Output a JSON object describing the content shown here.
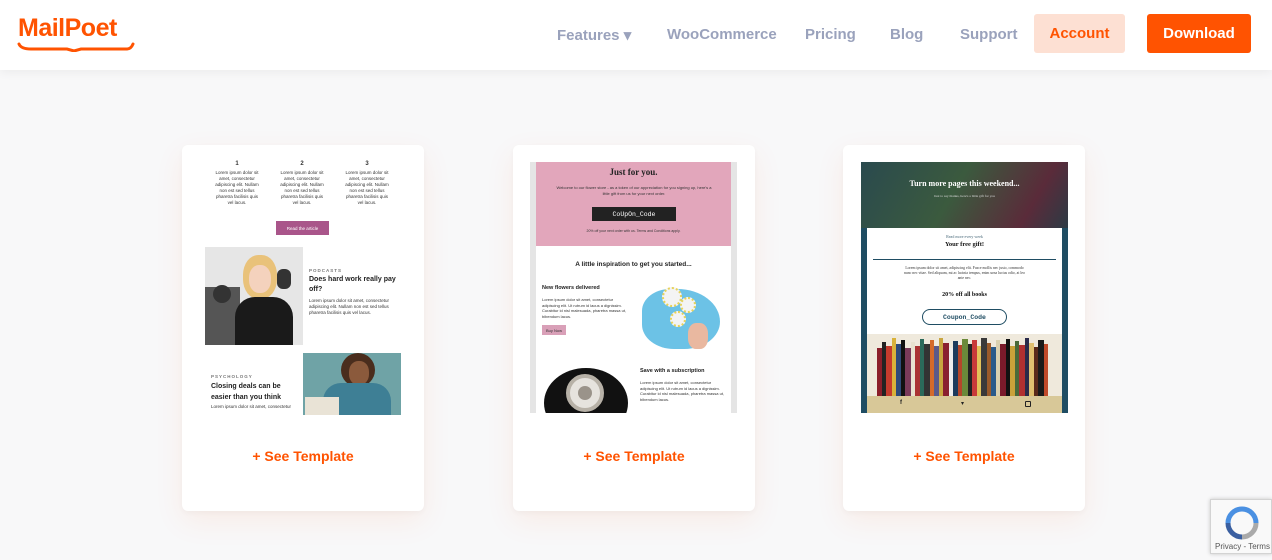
{
  "brand": {
    "name": "MailPoet",
    "accent": "#ff5301",
    "nav_color": "#9aa2bc"
  },
  "nav": {
    "features": "Features ▾",
    "woocommerce": "WooCommerce",
    "pricing": "Pricing",
    "blog": "Blog",
    "support": "Support",
    "account": "Account",
    "download": "Download"
  },
  "cards": [
    {
      "see_template": "+ See Template",
      "columns": [
        {
          "num": "1",
          "text": "Lorem ipsum dolor sit amet, consectetur adipiscing elit. Nullam non est sed tellus pharetra facilisis quis vel lacus."
        },
        {
          "num": "2",
          "text": "Lorem ipsum dolor sit amet, consectetur adipiscing elit. Nullam non est sed tellus pharetra facilisis quis vel lacus."
        },
        {
          "num": "3",
          "text": "Lorem ipsum dolor sit amet, consectetur adipiscing elit. Nullam non est sed tellus pharetra facilisis quis vel lacus."
        }
      ],
      "read_button": "Read the article",
      "article1": {
        "kicker": "PODCASTS",
        "title": "Does hard work really pay off?",
        "text": "Lorem ipsum dolor sit amet, consectetur adipiscing elit. Nullam non est sed tellus pharetra facilisis quis vel lacus."
      },
      "article2": {
        "kicker": "PSYCHOLOGY",
        "title": "Closing deals can be easier than you think",
        "text": "Lorem ipsum dolor sit amet, consectetur"
      }
    },
    {
      "see_template": "+ See Template",
      "heading": "Just for you.",
      "intro": "Welcome to our flower store - as a token of our appreciation for you signing up, here's a little gift from us for your next order.",
      "coupon": "CoUpOn_Code",
      "fineprint": "20% off your next order with us. Terms and Conditions apply.",
      "inspiration": "A little inspiration to get you started...",
      "item1": {
        "title": "New flowers delivered",
        "text": "Lorem ipsum dolor sit amet, consectetur adipiscing elit. Ut rutrum id lacus a dignissim. Curabitur id nisl malesuada, pharetra massa ut, bibendum lacus.",
        "button": "Buy Now"
      },
      "item2": {
        "title": "Save with a subscription",
        "text": "Lorem ipsum dolor sit amet, consectetur adipiscing elit. Ut rutrum id lacus a dignissim. Curabitur id nisl malesuada, pharetra massa ut, bibendum lacus."
      }
    },
    {
      "see_template": "+ See Template",
      "banner": "Turn more pages this weekend...",
      "banner_sub": "Just to say thanks, here's a little gift for you",
      "small_link": "Read more every week",
      "gift": "Your free gift!",
      "text": "Lorem ipsum dolor sit amet, adipiscing elit. Fusce mollis nec justo, commodo nunc nec vitae. Sed aliquam, mi ac lacinia tempus, enim urna luctus odio, at leo ante nec.",
      "offer": "20% off all books",
      "coupon": "Coupon_Code",
      "social": [
        "f",
        "t",
        "ig"
      ]
    }
  ],
  "recaptcha": {
    "links": "Privacy - Terms"
  }
}
